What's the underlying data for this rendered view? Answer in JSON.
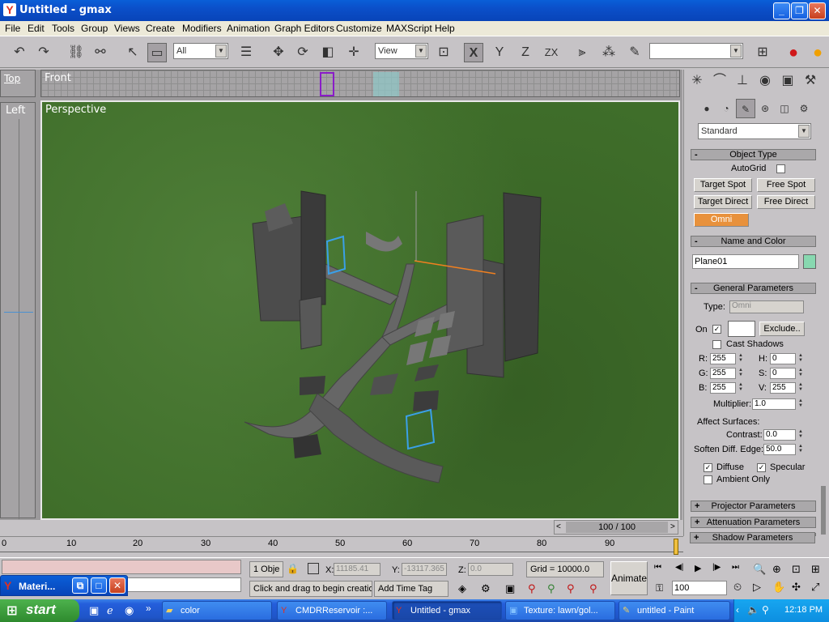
{
  "window": {
    "title": "Untitled - gmax",
    "app_icon": "gmax-logo-icon",
    "controls": [
      "minimize-icon",
      "restore-icon",
      "close-icon"
    ]
  },
  "menubar": {
    "items": [
      "File",
      "Edit",
      "Tools",
      "Group",
      "Views",
      "Create",
      "Modifiers",
      "Animation",
      "Graph Editors",
      "Customize",
      "MAXScript",
      "Help"
    ]
  },
  "toolbar": {
    "selection_filter": "All",
    "ref_coord": "View",
    "axis_x": "X",
    "axis_y": "Y",
    "axis_z": "Z",
    "axis_zx": "ZX"
  },
  "viewports": {
    "top": "Top",
    "front": "Front",
    "left": "Left",
    "perspective": "Perspective"
  },
  "timeslider": {
    "label": "100 / 100",
    "ticks": [
      "0",
      "10",
      "20",
      "30",
      "40",
      "50",
      "60",
      "70",
      "80",
      "90"
    ]
  },
  "command_panel": {
    "category": "Standard",
    "object_type": {
      "title": "Object Type",
      "autogrid": "AutoGrid",
      "buttons": [
        "Target Spot",
        "Free Spot",
        "Target Direct",
        "Free Direct",
        "Omni"
      ],
      "selected": "Omni"
    },
    "name_color": {
      "title": "Name and Color",
      "name": "Plane01",
      "color": "#88d8b0"
    },
    "general": {
      "title": "General Parameters",
      "type_label": "Type:",
      "type_value": "Omni",
      "on_label": "On",
      "exclude_label": "Exclude..",
      "cast_shadows": "Cast Shadows",
      "r_label": "R:",
      "r": "255",
      "g_label": "G:",
      "g": "255",
      "b_label": "B:",
      "b": "255",
      "h_label": "H:",
      "h": "0",
      "s_label": "S:",
      "s": "0",
      "v_label": "V:",
      "v": "255",
      "multiplier_label": "Multiplier:",
      "multiplier": "1.0",
      "affect_surfaces": "Affect Surfaces:",
      "contrast_label": "Contrast:",
      "contrast": "0.0",
      "soften_label": "Soften Diff. Edge:",
      "soften": "50.0",
      "diffuse": "Diffuse",
      "specular": "Specular",
      "ambient_only": "Ambient Only"
    },
    "collapsed_rollouts": [
      "Projector Parameters",
      "Attenuation Parameters",
      "Shadow Parameters"
    ]
  },
  "status": {
    "selection": "1 Obje",
    "x_label": "X:",
    "x": "11185.41",
    "y_label": "Y:",
    "y": "-13117.365",
    "z_label": "Z:",
    "z": "0.0",
    "grid": "Grid = 10000.0",
    "prompt": "Click and drag to begin creatio",
    "add_time_tag": "Add Time Tag",
    "animate": "Animate",
    "frame": "100"
  },
  "material_editor": {
    "title": "Materi..."
  },
  "taskbar": {
    "start": "start",
    "tasks": [
      "color",
      "CMDRReservoir :...",
      "Untitled - gmax",
      "Texture: lawn/gol...",
      "untitled - Paint"
    ],
    "active": "Untitled - gmax",
    "clock": "12:18 PM"
  }
}
